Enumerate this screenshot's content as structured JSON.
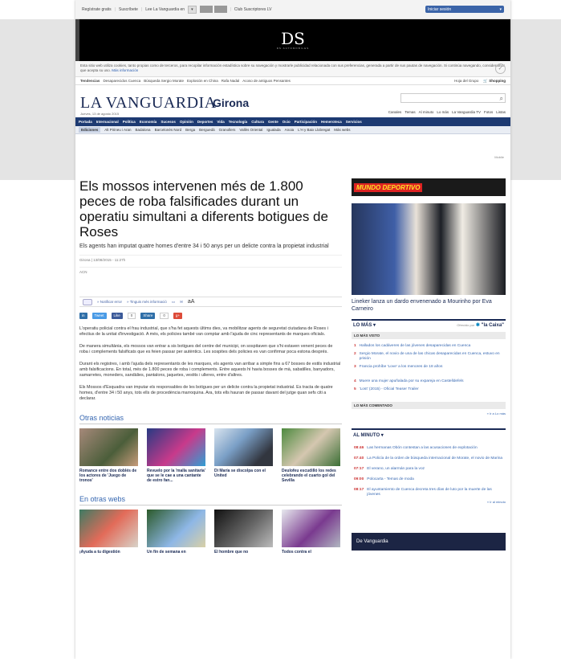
{
  "topbar": {
    "items": [
      "Regístrate gratis",
      "Suscríbete",
      "Lee La Vanguardia en"
    ],
    "club": "Club Suscriptores LV",
    "login": "Iniciar sesión"
  },
  "banner": {
    "brand": "DS",
    "tagline": "DS AUTOMOBILES"
  },
  "cookie": {
    "text": "Esta sitio web utiliza cookies, tanto propias como de terceros, para recopilar información estadística sobre su navegación y mostrarle publicidad relacionada con sus preferencias, generada a partir de sus pautas de navegación. Si continúa navegando, consideramos que acepta su uso.",
    "link": "Más información"
  },
  "trend": {
    "items": [
      "Tendencias",
      "Desaparecidos Cuenca",
      "Búsqueda Sergio Morate",
      "Explosión en China",
      "Rafa Nadal",
      "Acoso de antiguos Pensantes"
    ],
    "right": "Hoja del Grupo",
    "shopping": "Shopping"
  },
  "masthead": {
    "logo": "LA VANGUARDIA",
    "edition": "Girona",
    "date": "Jueves, 13 de agosto 2015",
    "quick": [
      "Canales",
      "Temas",
      "Al minuto",
      "Lo más",
      "La Vanguardia TV",
      "Fotos",
      "Listas"
    ]
  },
  "mainnav": [
    "Portada",
    "Internacional",
    "Política",
    "Economía",
    "Sucesos",
    "Opinión",
    "Deportes",
    "Vida",
    "Tecnología",
    "Cultura",
    "Gente",
    "Ocio",
    "Participación",
    "Hemeroteca",
    "Servicios"
  ],
  "subnav": [
    "Ediciones",
    "Alt Pirineu i Aran",
    "Badalona",
    "Barcelonès Nord",
    "Berga",
    "Berguedà",
    "Granollers",
    "Vallès Oriental",
    "Igualada",
    "Anoia",
    "L'H y Baix Llobregat",
    "Más webs"
  ],
  "rss": "Mobile",
  "article": {
    "headline": "Els mossos intervenen més de 1.800 peces de roba falsificades durant un operatiu simultani a diferents botigues de Roses",
    "subhead": "Els agents han imputat quatre homes d'entre 34 i 50 anys per un delicte contra la propietat industrial",
    "byline": "Girona | 13/08/2015 - 11:27h",
    "agency": "ACN",
    "tools": [
      "Notificar error",
      "Tinguis més informació"
    ],
    "share": {
      "tweet": "Tweet",
      "like": "Like",
      "share": "Share"
    },
    "paragraphs": [
      "L'operatiu policial contra el frau industrial, que s'ha fet aquests últims dies, va mobilitzar agents de seguretat ciutadana de Roses i efectius de la unitat d'investigació. A més, els policies també van comptar amb l'ajuda de cinc representants de marques oficials.",
      "De manera simultània, els mossos van entrar a sis botigues del centre del municipi, on sospitaven que s'hi estaven venent peces de roba i complements falsificats que es feien passar per autèntics. Les sospites dels policies es van confirmar poca estona després.",
      "Durant els registres, i amb l'ajuda dels representants de les marques, els agents van arribar a simple fins a 67 bosses de estils industrial amb falsificacions. En total, més de 1.800 peces de roba i complements. Entre aquests hi havia bosses de mà, sabatilles, banyadors, samarretes, moneders, sandàlies, pantalons, jaquetes, vestits i ulleres, entre d'altres.",
      "Els Mossos d'Esquadra van imputar els responsables de les botigues per un delicte contra la propietat industrial. Es tracta de quatre homes, d'entre 34 i 50 anys, tots ells de procedència marroquina. Ara, tots ells hauran de passar davant del jutge quan sefs citi a declarar."
    ]
  },
  "others": {
    "title": "Otras noticias",
    "cards": [
      "Romance entre dos doblés de los actores de 'Juego de tronos'",
      "Revuelo por la 'malla sanitaria' que se le cae a una cantante de estro fan...",
      "Di María se discolpa con el United",
      "Deulofeu escudilló los redes celebrando el cuarto gol del Sevilla"
    ]
  },
  "web": {
    "title": "En otras webs",
    "cards": [
      "¡Ayuda a tu digestión",
      "Un fin de semana en",
      "El hombre que no",
      "Todos contra el"
    ]
  },
  "sidebar": {
    "mundo": "MUNDO DEPORTIVO",
    "caption": "Lineker lanza un dardo envenenado a Mourinho por Eva Carneiro",
    "lomas": "LO MÁS",
    "offered": "Ofrecido por",
    "caixa": "\"la Caixa\"",
    "visto": "LO MÁS VISTO",
    "list": [
      "Hallados los cadáveres de las jóvenes desaparecidas en Cuenca",
      "Sergio Morate, el novio de una de las chicas desaparecidas en Cuenca, estuvo en prisión",
      "Francia prohíbe 'Love' a los menores de 18 años",
      "Muere una mujer apuñalada por su expareja en Castelldefels",
      "'Lost' (2015) - Oficial Teaser Trailer"
    ],
    "comentado": "LO MÁS COMENTADO",
    "more1": "» Ir a Lo más",
    "minuto": "AL MINUTO",
    "minlist": [
      {
        "t": "08:46",
        "s": "Las hermanas Obón contestan a las acusaciones de explotación"
      },
      {
        "t": "07:40",
        "s": "La Policía de la orden de búsqueda internacional de Morate, el novio de Marina"
      },
      {
        "t": "07:17",
        "s": "El verano, un alarmán para la voz"
      },
      {
        "t": "09:00",
        "s": "Polocarta - Temas de moda"
      },
      {
        "t": "08:17",
        "s": "El ayuntamiento de Cuenca decreta tres días de luto por la muerte de las jóvenes"
      }
    ],
    "more2": "» Ir al minuto",
    "vad": "De Vanguardia"
  }
}
